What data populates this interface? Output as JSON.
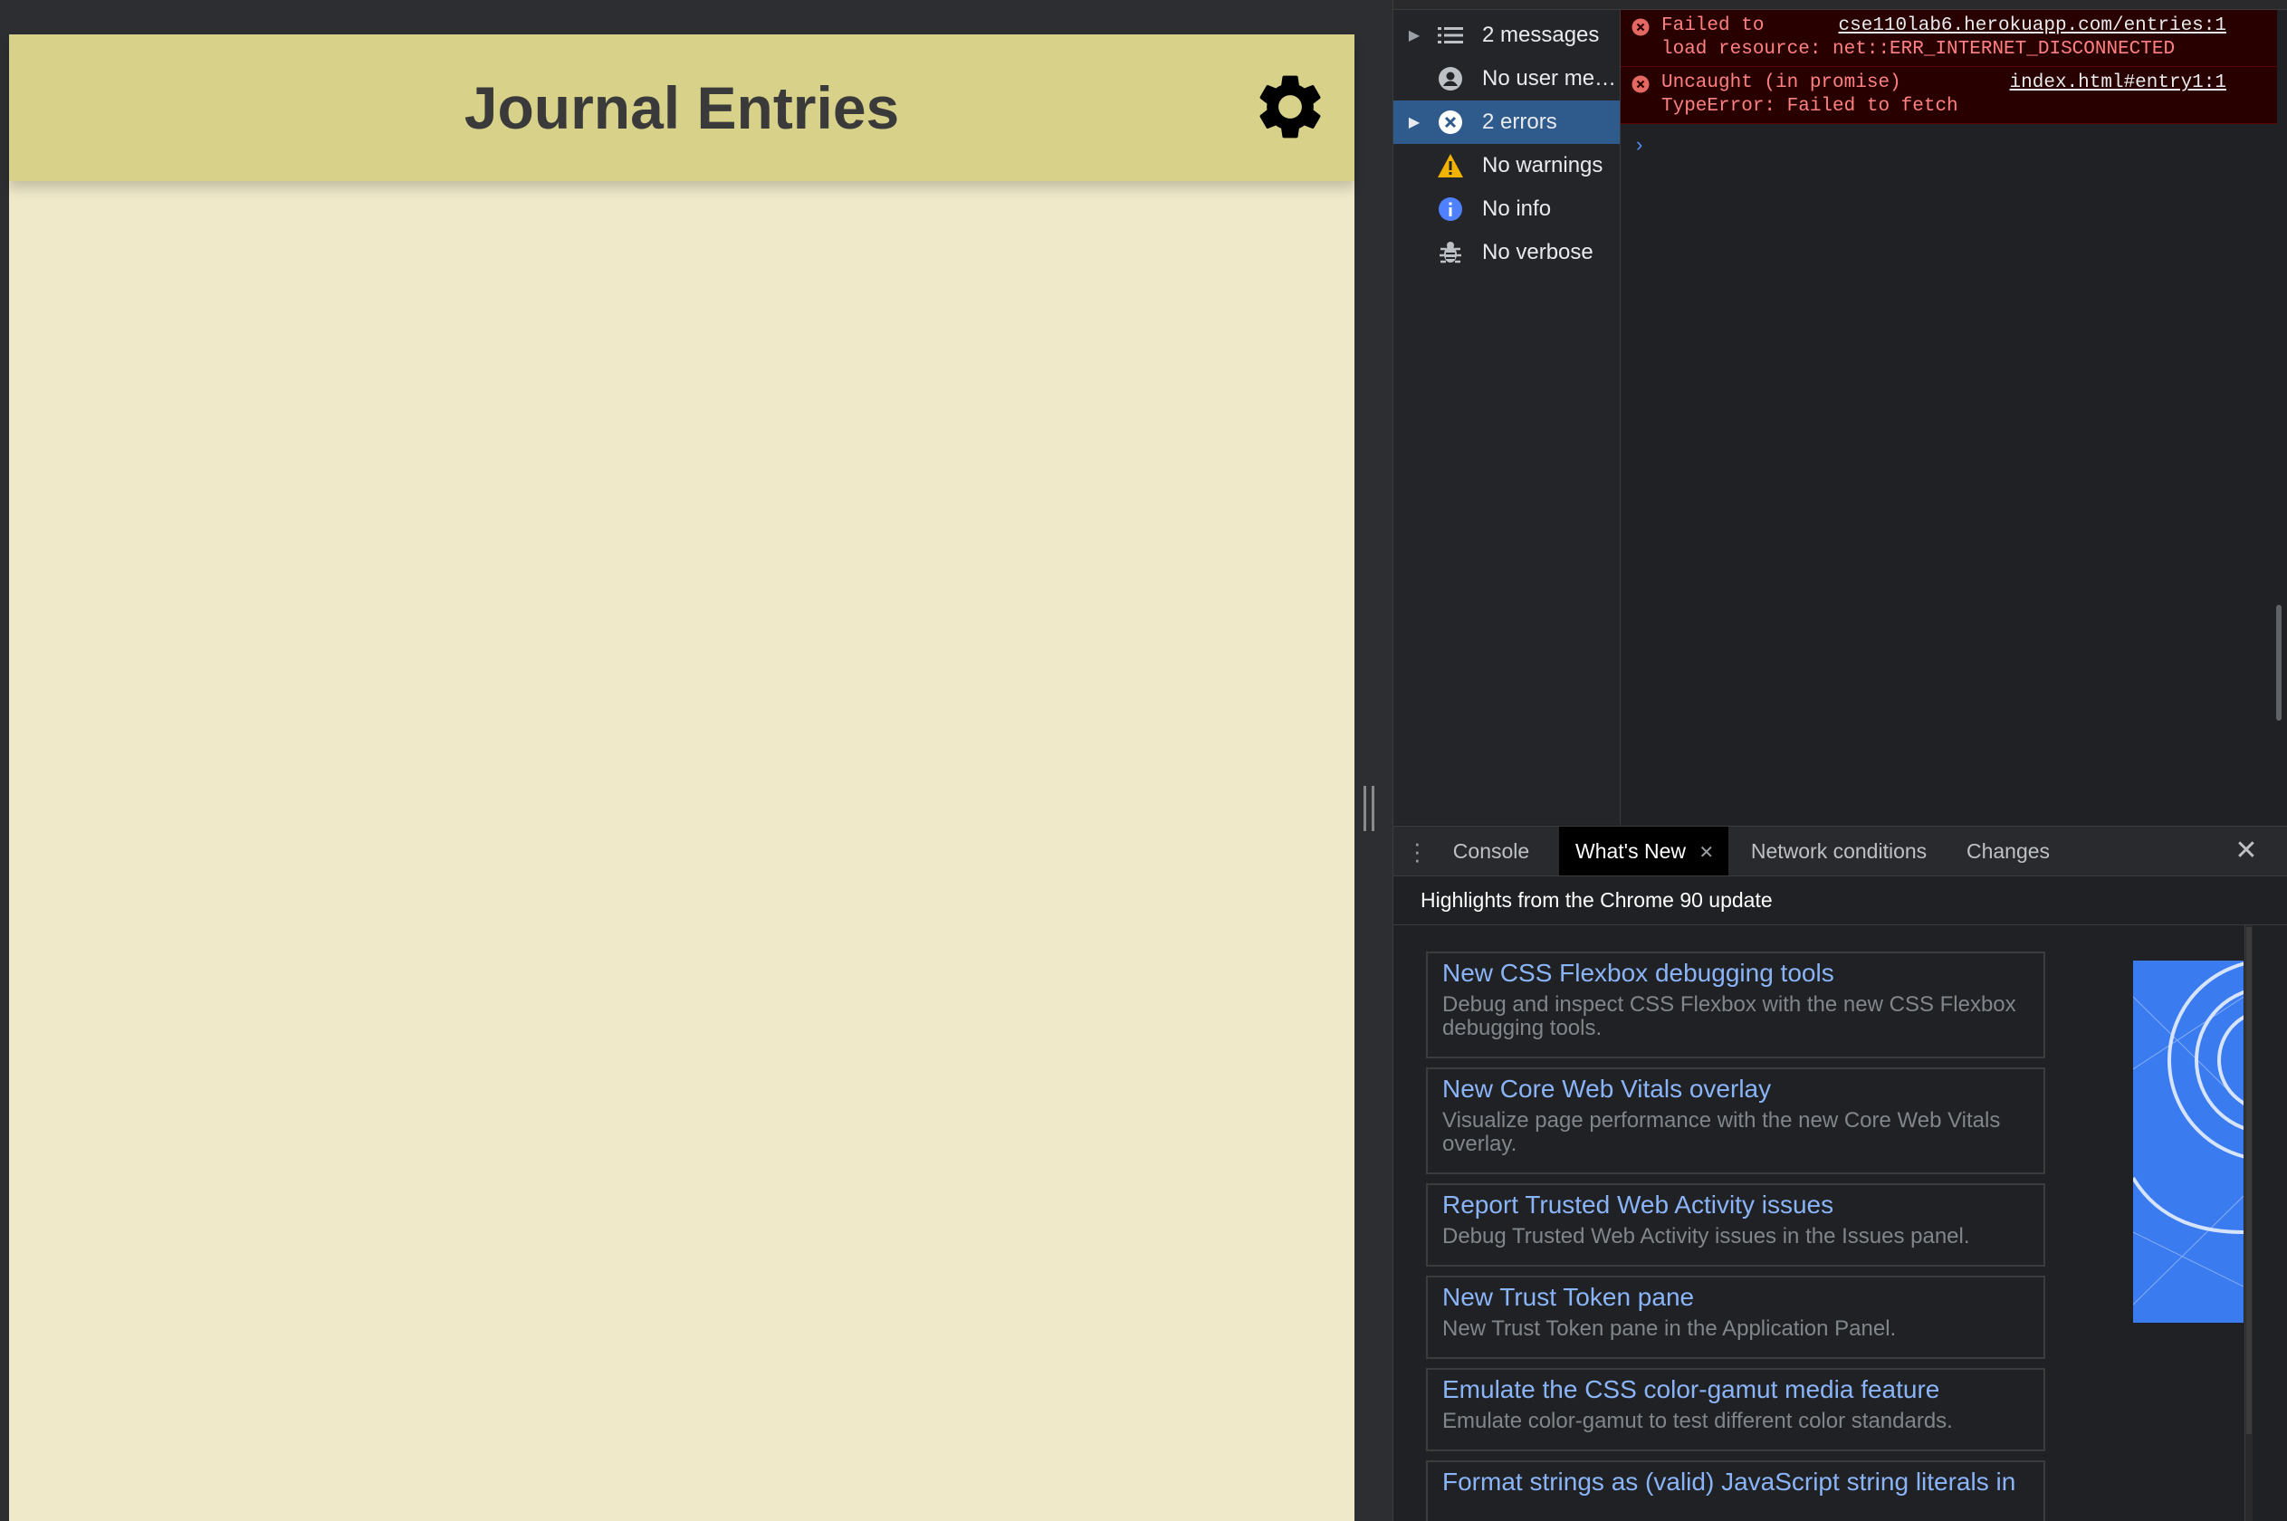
{
  "page": {
    "title": "Journal Entries",
    "settings_icon": "gear-icon",
    "colors": {
      "header": "#d8d18a",
      "body": "#efe8c9",
      "title": "#3a3a3a"
    }
  },
  "devtools": {
    "sidebar": {
      "items": [
        {
          "label": "2 messages",
          "icon": "list-icon",
          "expandable": true,
          "selected": false
        },
        {
          "label": "No user me…",
          "icon": "user-icon",
          "expandable": false,
          "selected": false
        },
        {
          "label": "2 errors",
          "icon": "error-icon",
          "expandable": true,
          "selected": true
        },
        {
          "label": "No warnings",
          "icon": "warning-icon",
          "expandable": false,
          "selected": false
        },
        {
          "label": "No info",
          "icon": "info-icon",
          "expandable": false,
          "selected": false
        },
        {
          "label": "No verbose",
          "icon": "bug-icon",
          "expandable": false,
          "selected": false
        }
      ]
    },
    "console": {
      "messages": [
        {
          "text": "Failed to\nload resource: net::ERR_INTERNET_DISCONNECTED",
          "source": "cse110lab6.herokuapp.com/entries:1"
        },
        {
          "text": "Uncaught (in promise)\nTypeError: Failed to fetch",
          "source": "index.html#entry1:1"
        }
      ],
      "prompt": "›"
    },
    "drawer": {
      "tabs": [
        {
          "label": "Console",
          "active": false,
          "closable": false
        },
        {
          "label": "What's New",
          "active": true,
          "closable": true
        },
        {
          "label": "Network conditions",
          "active": false,
          "closable": false
        },
        {
          "label": "Changes",
          "active": false,
          "closable": false
        }
      ],
      "close_symbol": "✕",
      "highlights": "Highlights from the Chrome 90 update",
      "items": [
        {
          "title": "New CSS Flexbox debugging tools",
          "description": "Debug and inspect CSS Flexbox with the new CSS Flexbox debugging tools."
        },
        {
          "title": "New Core Web Vitals overlay",
          "description": "Visualize page performance with the new Core Web Vitals overlay."
        },
        {
          "title": "Report Trusted Web Activity issues",
          "description": "Debug Trusted Web Activity issues in the Issues panel."
        },
        {
          "title": "New Trust Token pane",
          "description": "New Trust Token pane in the Application Panel."
        },
        {
          "title": "Emulate the CSS color-gamut media feature",
          "description": "Emulate color-gamut to test different color standards."
        },
        {
          "title": "Format strings as (valid) JavaScript string literals in",
          "description": ""
        }
      ]
    }
  }
}
